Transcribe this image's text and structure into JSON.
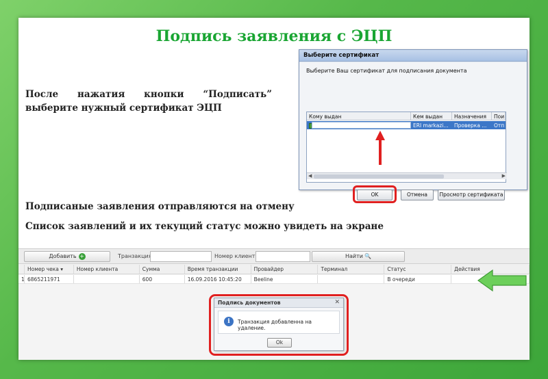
{
  "slide": {
    "title": "Подпись заявления с ЭЦП",
    "instruction": "После нажатия кнопки “Подписать” выберите нужный сертификат ЭЦП",
    "line1": "Подписаные заявления отправляются на отмену",
    "line2": "Список заявлений и их текущий статус можно увидеть на экране"
  },
  "cert_dialog": {
    "title": "Выберите сертификат",
    "prompt": "Выберите Ваш сертификат для подписания документа",
    "columns": [
      "Кому выдан",
      "Кем выдан",
      "Назначения",
      "Пои"
    ],
    "row": {
      "to": "",
      "by": "ERI markazi...",
      "purpose": "Проверка ...",
      "extra": "Отп"
    },
    "buttons": {
      "ok": "OK",
      "cancel": "Отмена",
      "view": "Просмотр сертификата"
    }
  },
  "grid": {
    "add_label": "Добавить",
    "transaction_label": "Транзакция",
    "client_label": "Номер клиента",
    "find_label": "Найти",
    "columns": [
      "Номер чека ▾",
      "Номер клиента",
      "Сумма",
      "Время транзакции",
      "Провайдер",
      "Терминал",
      "Статус",
      "Действия"
    ],
    "row": {
      "index": "1",
      "check": "6865211971",
      "client": "",
      "sum": "600",
      "time": "16.09.2016 10:45:20",
      "provider": "Beeline",
      "terminal": "",
      "status": "В очереди",
      "actions": ""
    }
  },
  "sign_dialog": {
    "title": "Подпись документов",
    "message": "Транзакция добавленна на удаление.",
    "ok": "Ok"
  },
  "colors": {
    "title_green": "#19a532",
    "highlight_red": "#e02020",
    "arrow_green": "#6ccf5a"
  }
}
